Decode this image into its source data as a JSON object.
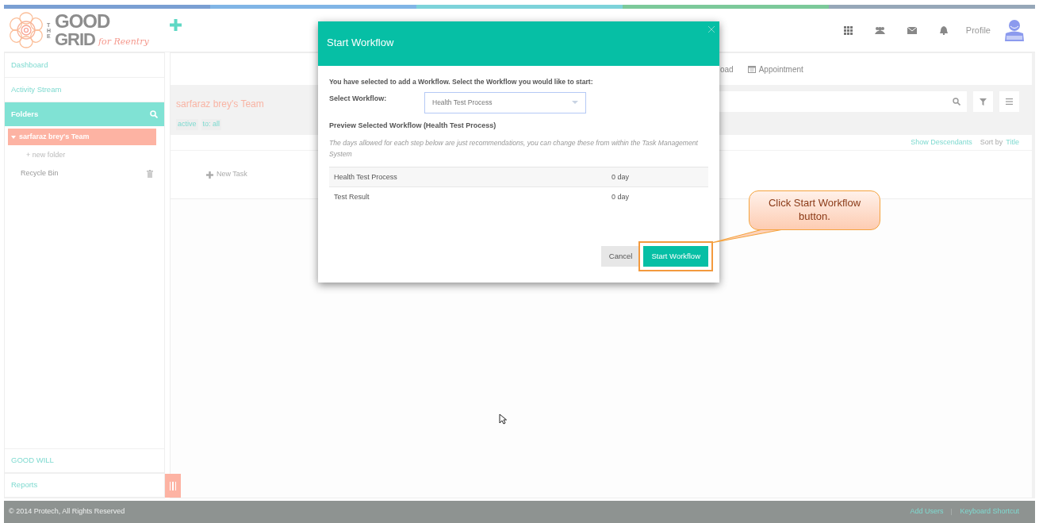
{
  "logo": {
    "the": "THE",
    "good": "GOOD",
    "grid": "GRID",
    "tagline": "for Reentry"
  },
  "header": {
    "profile_label": "Profile"
  },
  "sidebar": {
    "nav": [
      {
        "label": "Dashboard",
        "selected": false
      },
      {
        "label": "Activity Stream",
        "selected": false
      }
    ],
    "folders_title": "Folders",
    "tree": [
      {
        "label": "sarfaraz brey's Team",
        "kind": "folder",
        "expanded": true,
        "selected": true
      },
      {
        "label": "Recycle Bin",
        "kind": "trash",
        "selected": false
      }
    ],
    "new_folder": "+ new folder",
    "bottom": [
      {
        "label": "GOOD WILL"
      },
      {
        "label": "Reports"
      }
    ]
  },
  "toolbar": [
    {
      "label": "oad",
      "kind": "plain"
    },
    {
      "label": "Appointment",
      "kind": "calendar"
    }
  ],
  "team": {
    "title": "sarfaraz brey's Team",
    "filters": [
      "active",
      "to: all"
    ]
  },
  "list_options": {
    "show_descendants": "Show Descendants",
    "sort_label": "Sort by",
    "sort_value": "Title"
  },
  "new_task": "New Task",
  "modal": {
    "title": "Start Workflow",
    "intro": "You have selected to add a Workflow. Select the Workflow you would like to start:",
    "select_label": "Select Workflow:",
    "select_value": "Health Test Process",
    "preview_title": "Preview Selected Workflow (Health Test Process)",
    "note": "The days allowed for each step below are just recommendations, you can change these from within the Task Management System",
    "steps": [
      {
        "name": "Health Test Process",
        "duration": "0 day"
      },
      {
        "name": "Test Result",
        "duration": "0 day"
      }
    ],
    "buttons": [
      {
        "label": "Cancel",
        "kind": "secondary",
        "highlighted": false
      },
      {
        "label": "Start Workflow",
        "kind": "primary",
        "highlighted": true
      }
    ]
  },
  "callout": {
    "text": "Click Start Workflow button."
  },
  "footer": {
    "copyright": "© 2014 Protech, All Rights Reserved",
    "links": [
      "Add Users",
      "Keyboard Shortcut"
    ]
  }
}
